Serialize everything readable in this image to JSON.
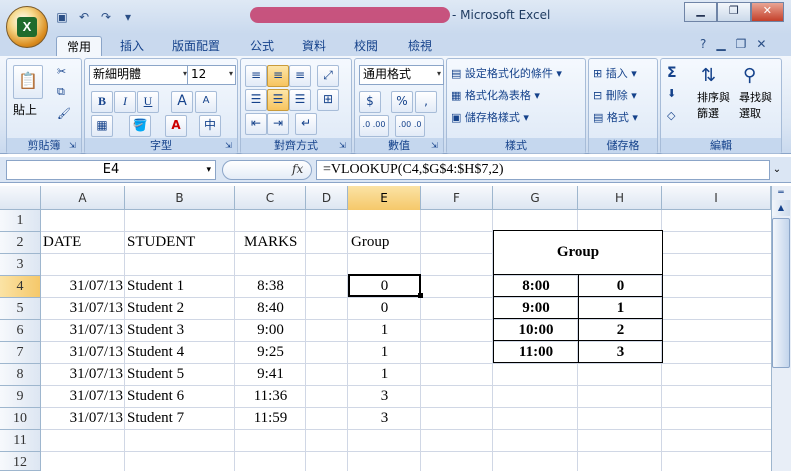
{
  "window": {
    "title": "- Microsoft Excel",
    "controls": {
      "minimize": "▁",
      "restore": "❐",
      "close": "✕"
    }
  },
  "app_logo": "X",
  "tabs": [
    "常用",
    "插入",
    "版面配置",
    "公式",
    "資料",
    "校閱",
    "檢視"
  ],
  "ribbon": {
    "clipboard": {
      "label": "剪貼簿",
      "paste": "貼上"
    },
    "font": {
      "label": "字型",
      "font_name": "新細明體",
      "font_size": "12",
      "bold": "B",
      "italic": "I",
      "underline": "U",
      "grow": "A",
      "shrink": "A",
      "phonetic": "中"
    },
    "alignment": {
      "label": "對齊方式"
    },
    "number": {
      "label": "數值",
      "format": "通用格式",
      "percent": "%",
      "comma": ",",
      "inc_decimal": ".0 .00",
      "dec_decimal": ".00 .0"
    },
    "styles": {
      "label": "樣式",
      "conditional": "設定格式化的條件",
      "format_table": "格式化為表格",
      "cell_styles": "儲存格樣式"
    },
    "cells": {
      "label": "儲存格",
      "insert": "插入",
      "delete": "刪除",
      "format": "格式"
    },
    "editing": {
      "label": "編輯",
      "sigma": "Σ",
      "sort_filter_1": "排序與",
      "sort_filter_2": "篩選",
      "find_select_1": "尋找與",
      "find_select_2": "選取"
    }
  },
  "formula_bar": {
    "name_box": "E4",
    "fx": "fx",
    "formula": "=VLOOKUP(C4,$G$4:$H$7,2)"
  },
  "columns": [
    "A",
    "B",
    "C",
    "D",
    "E",
    "F",
    "G",
    "H",
    "I"
  ],
  "rows": [
    "1",
    "2",
    "3",
    "4",
    "5",
    "6",
    "7",
    "8",
    "9",
    "10",
    "11",
    "12"
  ],
  "headers": {
    "date": "DATE",
    "student": "STUDENT",
    "marks": "MARKS",
    "group": "Group"
  },
  "records": [
    {
      "date": "31/07/13",
      "student": "Student 1",
      "marks": "8:38",
      "group": "0"
    },
    {
      "date": "31/07/13",
      "student": "Student 2",
      "marks": "8:40",
      "group": "0"
    },
    {
      "date": "31/07/13",
      "student": "Student 3",
      "marks": "9:00",
      "group": "1"
    },
    {
      "date": "31/07/13",
      "student": "Student 4",
      "marks": "9:25",
      "group": "1"
    },
    {
      "date": "31/07/13",
      "student": "Student 5",
      "marks": "9:41",
      "group": "1"
    },
    {
      "date": "31/07/13",
      "student": "Student 6",
      "marks": "11:36",
      "group": "3"
    },
    {
      "date": "31/07/13",
      "student": "Student 7",
      "marks": "11:59",
      "group": "3"
    }
  ],
  "lookup": {
    "title": "Group",
    "rows": [
      {
        "time": "8:00",
        "group": "0"
      },
      {
        "time": "9:00",
        "group": "1"
      },
      {
        "time": "10:00",
        "group": "2"
      },
      {
        "time": "11:00",
        "group": "3"
      }
    ]
  },
  "colors": {
    "ribbon_text": "#15428b",
    "selection": "#f5c86a",
    "redaction": "#c43a6a"
  }
}
